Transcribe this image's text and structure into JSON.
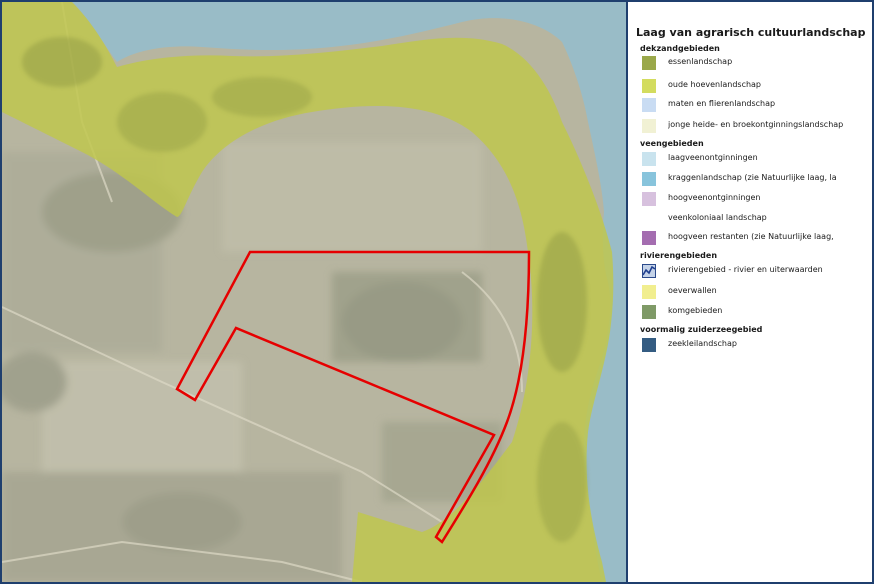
{
  "map": {
    "label": "Luchtfoto met plangebied en laag van agrarisch cultuurlandschap"
  },
  "legend": {
    "title": "Laag van agrarisch cultuurlandschap",
    "groups": [
      {
        "header": "dekzandgebieden",
        "items": [
          {
            "label": "essenlandschap",
            "color": "#9aa84a"
          },
          {
            "label": "oude hoevenlandschap",
            "color": "#d3dc5f"
          },
          {
            "label": "maten en flierenlandschap",
            "color": "#c9dcf3"
          },
          {
            "label": "jonge heide- en broekontginningslandschap",
            "color": "#f1f1d4"
          }
        ]
      },
      {
        "header": "veengebieden",
        "items": [
          {
            "label": "laagveenontginningen",
            "color": "#c9e3ee"
          },
          {
            "label": "kraggenlandschap (zie Natuurlijke laag, la",
            "color": "#88c4dc"
          },
          {
            "label": "hoogveenontginningen",
            "color": "#d7c1de"
          },
          {
            "label": "veenkoloniaal landschap",
            "color": "#ffffff"
          },
          {
            "label": "hoogveen restanten (zie Natuurlijke laag,",
            "color": "#a46db0"
          }
        ]
      },
      {
        "header": "rivierengebieden",
        "items": [
          {
            "label": "rivierengebied - rivier en uiterwaarden",
            "color": "#c5d3e8",
            "icon": "river-icon"
          },
          {
            "label": "oeverwallen",
            "color": "#f1ee8f"
          },
          {
            "label": "komgebieden",
            "color": "#7f9a67"
          }
        ]
      },
      {
        "header": "voormalig zuiderzeegebied",
        "items": [
          {
            "label": "zeekleilandschap",
            "color": "#345c82"
          }
        ]
      }
    ]
  }
}
